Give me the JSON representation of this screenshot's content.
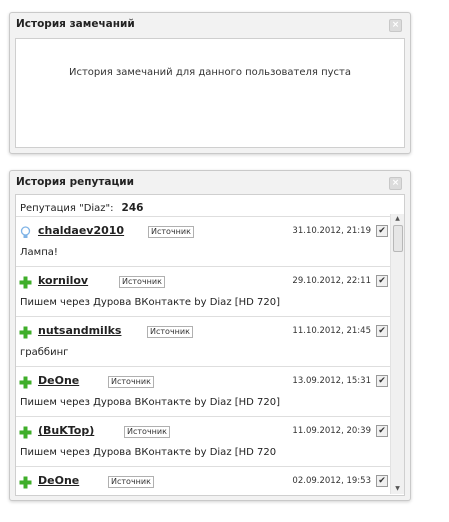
{
  "notes_panel": {
    "title": "История замечаний",
    "close_label": "×",
    "empty_message": "История замечаний для данного пользователя пуста"
  },
  "rep_panel": {
    "title": "История репутации",
    "close_label": "×",
    "rep_label": "Репутация \"Diaz\":",
    "rep_value": "246",
    "entries": [
      {
        "icon": "lightbulb-icon",
        "user": "chaldaev2010",
        "source": "Источник",
        "date": "31.10.2012, 21:19",
        "check": "✔",
        "text": "Лампа!"
      },
      {
        "icon": "plus-icon",
        "user": "kornilov",
        "source": "Источник",
        "date": "29.10.2012, 22:11",
        "check": "✔",
        "text": "Пишем через Дурова ВКонтакте by Diaz [HD 720]"
      },
      {
        "icon": "plus-icon",
        "user": "nutsandmilks",
        "source": "Источник",
        "date": "11.10.2012, 21:45",
        "check": "✔",
        "text": "граббинг"
      },
      {
        "icon": "plus-icon",
        "user": "DeOne",
        "source": "Источник",
        "date": "13.09.2012, 15:31",
        "check": "✔",
        "text": "Пишем через Дурова ВКонтакте by Diaz [HD 720]"
      },
      {
        "icon": "plus-icon",
        "user": "(BuKTop)",
        "source": "Источник",
        "date": "11.09.2012, 20:39",
        "check": "✔",
        "text": "Пишем через Дурова ВКонтакте by Diaz [HD 720"
      },
      {
        "icon": "plus-icon",
        "user": "DeOne",
        "source": "Источник",
        "date": "02.09.2012, 19:53",
        "check": "✔",
        "text": ""
      }
    ],
    "scroll_up_glyph": "▲",
    "scroll_down_glyph": "▼"
  },
  "colors": {
    "plus_green": "#3fae2a",
    "bulb_blue": "#7fb3e6"
  }
}
